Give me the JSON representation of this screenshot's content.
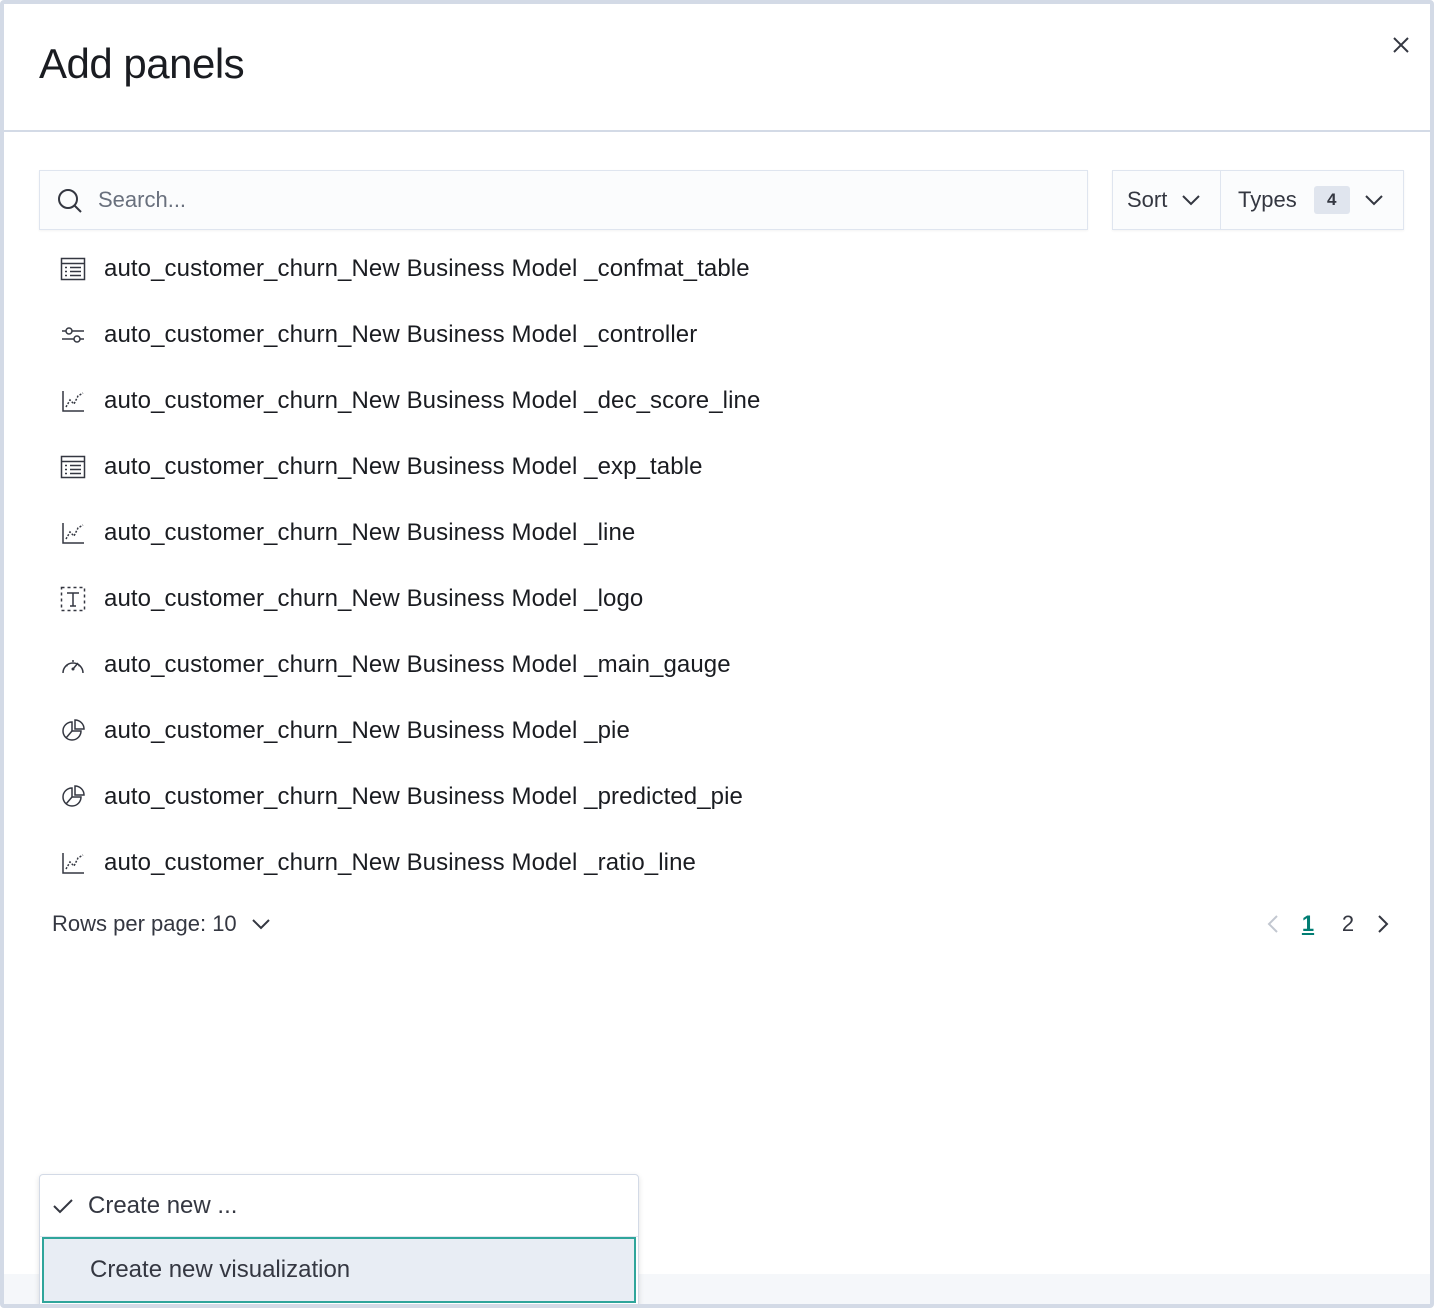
{
  "header": {
    "title": "Add panels"
  },
  "search": {
    "placeholder": "Search..."
  },
  "filters": {
    "sort_label": "Sort",
    "types_label": "Types",
    "types_count": "4"
  },
  "items": [
    {
      "label": "auto_customer_churn_New Business Model _confmat_table",
      "icon": "table-icon"
    },
    {
      "label": "auto_customer_churn_New Business Model _controller",
      "icon": "controls-icon"
    },
    {
      "label": "auto_customer_churn_New Business Model _dec_score_line",
      "icon": "line-chart-icon"
    },
    {
      "label": "auto_customer_churn_New Business Model _exp_table",
      "icon": "table-icon"
    },
    {
      "label": "auto_customer_churn_New Business Model _line",
      "icon": "line-chart-icon"
    },
    {
      "label": "auto_customer_churn_New Business Model _logo",
      "icon": "text-icon"
    },
    {
      "label": "auto_customer_churn_New Business Model _main_gauge",
      "icon": "gauge-icon"
    },
    {
      "label": "auto_customer_churn_New Business Model _pie",
      "icon": "pie-chart-icon"
    },
    {
      "label": "auto_customer_churn_New Business Model _predicted_pie",
      "icon": "pie-chart-icon"
    },
    {
      "label": "auto_customer_churn_New Business Model _ratio_line",
      "icon": "line-chart-icon"
    }
  ],
  "pagination": {
    "rows_per_page_label": "Rows per page: 10",
    "pages": [
      "1",
      "2"
    ],
    "current_page": "1"
  },
  "create_menu": {
    "header_option": "Create new ...",
    "selected_option": "Create new visualization"
  },
  "colors": {
    "accent": "#017d73",
    "focus_border": "#2fa59b",
    "border": "#d3dae6",
    "text": "#343741"
  }
}
